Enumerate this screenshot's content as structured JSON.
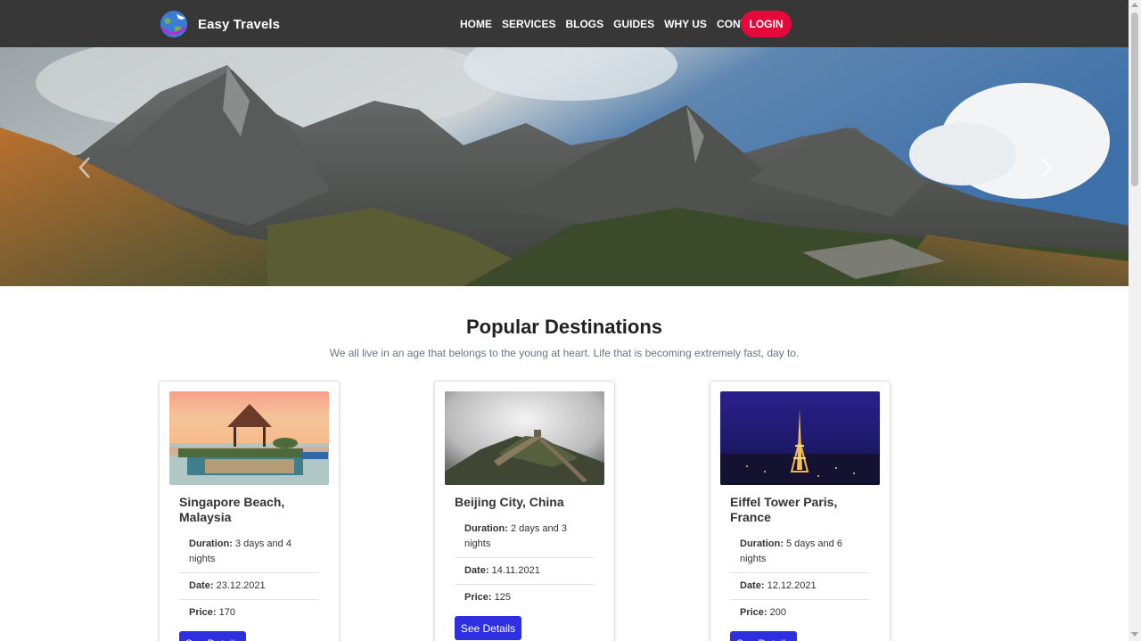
{
  "brand": {
    "name": "Easy Travels",
    "logo_icon": "globe-plane-icon"
  },
  "nav": {
    "links": [
      "HOME",
      "SERVICES",
      "BLOGS",
      "GUIDES",
      "WHY US",
      "CONTACT"
    ],
    "login_label": "LOGIN"
  },
  "colors": {
    "navbar": "#373737",
    "login": "#e5083a",
    "button": "#2f2fe2"
  },
  "hero": {
    "image": "mountain-landscape",
    "prev_icon": "chevron-left-icon",
    "next_icon": "chevron-right-icon"
  },
  "section": {
    "title": "Popular Destinations",
    "subtitle": "We all live in an age that belongs to the young at heart. Life that is becoming extremely fast, day to."
  },
  "labels": {
    "duration": "Duration:",
    "date": "Date:",
    "price": "Price:",
    "see_details": "See Details"
  },
  "cards": [
    {
      "title": "Singapore Beach, Malaysia",
      "duration": "3 days and 4 nights",
      "date": "23.12.2021",
      "price": "170"
    },
    {
      "title": "Beijing City, China",
      "duration": "2 days and 3 nights",
      "date": "14.11.2021",
      "price": "125"
    },
    {
      "title": "Eiffel Tower Paris, France",
      "duration": "5 days and 6 nights",
      "date": "12.12.2021",
      "price": "200"
    }
  ]
}
